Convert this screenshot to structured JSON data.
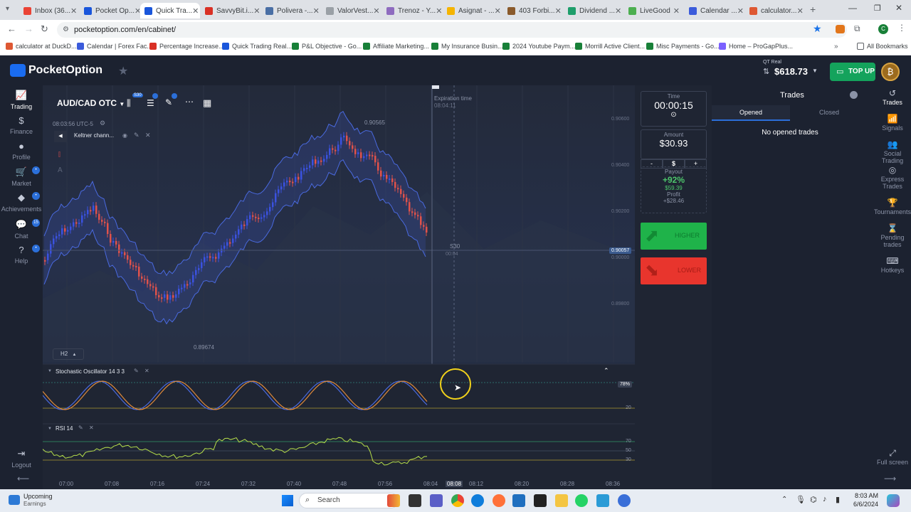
{
  "browser": {
    "tabs": [
      {
        "title": "Inbox (36...",
        "color": "#ea4335"
      },
      {
        "title": "Pocket Op...",
        "color": "#1a56db"
      },
      {
        "title": "Quick Tra...",
        "color": "#1a56db",
        "active": true
      },
      {
        "title": "SavvyBit.i...",
        "color": "#d93025"
      },
      {
        "title": "Polivera -...",
        "color": "#4a6fa5"
      },
      {
        "title": "ValorVest...",
        "color": "#9aa0a6"
      },
      {
        "title": "Trenoz - Y...",
        "color": "#8e6bbf"
      },
      {
        "title": "Asignat - ...",
        "color": "#f5b400"
      },
      {
        "title": "403 Forbi...",
        "color": "#8a5a2b"
      },
      {
        "title": "Dividend ...",
        "color": "#1e9e6b"
      },
      {
        "title": "LiveGood",
        "color": "#4caf50"
      },
      {
        "title": "Calendar ...",
        "color": "#3b5bdb"
      },
      {
        "title": "calculator...",
        "color": "#de5833"
      }
    ],
    "url": "pocketoption.com/en/cabinet/",
    "bookmarks": [
      {
        "label": "calculator at DuckD...",
        "color": "#de5833"
      },
      {
        "label": "Calendar | Forex Fac...",
        "color": "#3b5bdb"
      },
      {
        "label": "Percentage Increase...",
        "color": "#d93025"
      },
      {
        "label": "Quick Trading Real...",
        "color": "#1a56db"
      },
      {
        "label": "P&L Objective - Go...",
        "color": "#188038"
      },
      {
        "label": "Affiliate Marketing...",
        "color": "#188038"
      },
      {
        "label": "My Insurance Busin...",
        "color": "#188038"
      },
      {
        "label": "2024 Youtube Paym...",
        "color": "#188038"
      },
      {
        "label": "Morrill Active Client...",
        "color": "#188038"
      },
      {
        "label": "Misc Payments - Go...",
        "color": "#188038"
      },
      {
        "label": "Home – ProGapPlus...",
        "color": "#7b61ff"
      }
    ],
    "all_bookmarks": "All Bookmarks"
  },
  "header": {
    "brand": "PocketOption",
    "account_type": "QT Real",
    "balance": "$618.73",
    "topup": "TOP UP"
  },
  "leftnav": [
    {
      "label": "Trading",
      "icon": "chart-icon",
      "active": true
    },
    {
      "label": "Finance",
      "icon": "dollar-icon"
    },
    {
      "label": "Profile",
      "icon": "user-icon"
    },
    {
      "label": "Market",
      "icon": "cart-icon",
      "badge": "•"
    },
    {
      "label": "Achievements",
      "icon": "diamond-icon",
      "badge": "•"
    },
    {
      "label": "Chat",
      "icon": "chat-icon",
      "badge": "15"
    },
    {
      "label": "Help",
      "icon": "help-icon",
      "badge": "•"
    }
  ],
  "logout": "Logout",
  "chart": {
    "pair": "AUD/CAD OTC",
    "timeframe_badge": "S30",
    "time_utc": "08:03:56 UTC-5",
    "indicator": "Keltner chann...",
    "timeframe": "H2",
    "expiration_label": "Expiration time",
    "expiration_time": "08:04:11",
    "high_label": "0.90565",
    "low_label": "0.89674",
    "current_price": "0.90057",
    "s30_label": "S30",
    "s30_time": "00:04",
    "price_ticks": [
      "0.90600",
      "0.90400",
      "0.90200",
      "0.90000",
      "0.89800"
    ],
    "time_ticks": [
      "07:00",
      "07:08",
      "07:16",
      "07:24",
      "07:32",
      "07:40",
      "07:48",
      "07:56",
      "08:04",
      "08:08",
      "08:12",
      "08:20",
      "08:28",
      "08:36"
    ],
    "stoch_label": "Stochastic Oscillator 14 3 3",
    "stoch_levels": [
      "78%",
      "20"
    ],
    "rsi_label": "RSI 14",
    "rsi_levels": [
      "70",
      "50",
      "30"
    ]
  },
  "controls": {
    "time_label": "Time",
    "time_value": "00:00:15",
    "amount_label": "Amount",
    "amount_value": "$30.93",
    "minus": "-",
    "currency": "$",
    "plus": "+",
    "payout_label": "Payout",
    "payout_pct": "+92%",
    "payout_amount": "$59.39",
    "profit_label": "Profit",
    "profit_value": "+$28.46",
    "higher": "HIGHER",
    "lower": "LOWER"
  },
  "trades": {
    "title": "Trades",
    "tab_opened": "Opened",
    "tab_closed": "Closed",
    "empty": "No opened trades"
  },
  "rightnav": [
    {
      "label": "Trades",
      "icon": "history-icon",
      "active": true
    },
    {
      "label": "Signals",
      "icon": "signal-icon"
    },
    {
      "label": "Social Trading",
      "icon": "social-icon"
    },
    {
      "label": "Express Trades",
      "icon": "express-icon"
    },
    {
      "label": "Tournaments",
      "icon": "trophy-icon"
    },
    {
      "label": "Pending trades",
      "icon": "hourglass-icon"
    },
    {
      "label": "Hotkeys",
      "icon": "keyboard-icon"
    }
  ],
  "fullscreen": "Full screen",
  "taskbar": {
    "weather_title": "Upcoming",
    "weather_sub": "Earnings",
    "search": "Search",
    "time": "8:03 AM",
    "date": "6/6/2024"
  }
}
